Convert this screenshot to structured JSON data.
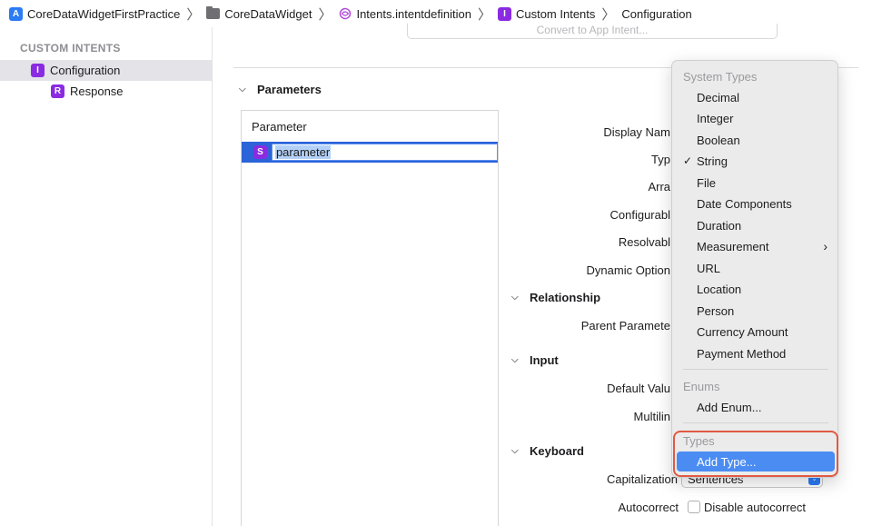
{
  "breadcrumb": {
    "items": [
      {
        "label": "CoreDataWidgetFirstPractice",
        "icon": "app-icon"
      },
      {
        "label": "CoreDataWidget",
        "icon": "folder-icon"
      },
      {
        "label": "Intents.intentdefinition",
        "icon": "intents-icon"
      },
      {
        "label": "Custom Intents",
        "icon": "intent-badge-icon",
        "badge": "I"
      },
      {
        "label": "Configuration"
      }
    ]
  },
  "sidebar": {
    "header": "CUSTOM INTENTS",
    "items": [
      {
        "label": "Configuration",
        "badge": "I"
      },
      {
        "label": "Response",
        "badge": "R"
      }
    ]
  },
  "main": {
    "top_button": "Convert to App Intent...",
    "parameters_title": "Parameters",
    "param_table": {
      "header": "Parameter",
      "rows": [
        {
          "badge": "S",
          "value": "parameter"
        }
      ]
    },
    "form": {
      "display_name": "Display Nam",
      "type": "Typ",
      "array": "Arra",
      "configurable": "Configurabl",
      "resolvable": "Resolvabl",
      "dynamic_options": "Dynamic Option"
    },
    "relationship_title": "Relationship",
    "parent_parameter": "Parent Paramete",
    "input_title": "Input",
    "default_value": "Default Valu",
    "multiline": "Multilin",
    "keyboard_title": "Keyboard",
    "capitalization_label": "Capitalization",
    "capitalization_value": "Sentences",
    "autocorrect_label": "Autocorrect",
    "autocorrect_option": "Disable autocorrect"
  },
  "menu": {
    "system_types_header": "System Types",
    "system_types": [
      "Decimal",
      "Integer",
      "Boolean",
      "String",
      "File",
      "Date Components",
      "Duration",
      "Measurement",
      "URL",
      "Location",
      "Person",
      "Currency Amount",
      "Payment Method"
    ],
    "checked": "String",
    "submenu_item": "Measurement",
    "enums_header": "Enums",
    "add_enum": "Add Enum...",
    "types_header": "Types",
    "add_type": "Add Type...",
    "highlight_color": "#4b8cf2",
    "annotation_color": "#e05a42"
  }
}
